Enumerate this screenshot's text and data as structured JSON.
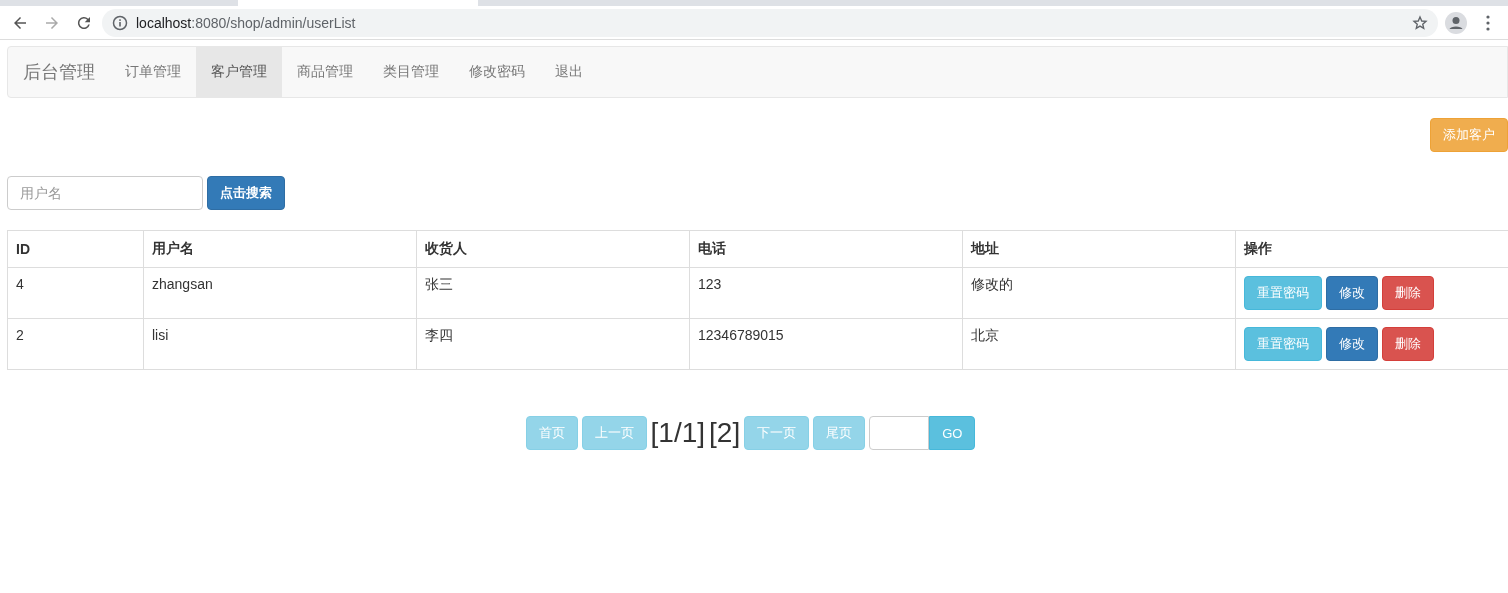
{
  "browser": {
    "url_host": "localhost",
    "url_rest": ":8080/shop/admin/userList"
  },
  "navbar": {
    "brand": "后台管理",
    "items": [
      {
        "label": "订单管理",
        "selected": false
      },
      {
        "label": "客户管理",
        "selected": true
      },
      {
        "label": "商品管理",
        "selected": false
      },
      {
        "label": "类目管理",
        "selected": false
      },
      {
        "label": "修改密码",
        "selected": false
      },
      {
        "label": "退出",
        "selected": false
      }
    ]
  },
  "add_button": "添加客户",
  "search": {
    "placeholder": "用户名",
    "button": "点击搜索"
  },
  "table": {
    "columns": [
      "ID",
      "用户名",
      "收货人",
      "电话",
      "地址",
      "操作"
    ],
    "rows": [
      {
        "cells": [
          "4",
          "zhangsan",
          "张三",
          "123",
          "修改的"
        ],
        "actions": [
          {
            "label": "重置密码",
            "kind": "info"
          },
          {
            "label": "修改",
            "kind": "primary"
          },
          {
            "label": "删除",
            "kind": "danger"
          }
        ]
      },
      {
        "cells": [
          "2",
          "lisi",
          "李四",
          "12346789015",
          "北京"
        ],
        "actions": [
          {
            "label": "重置密码",
            "kind": "info"
          },
          {
            "label": "修改",
            "kind": "primary"
          },
          {
            "label": "删除",
            "kind": "danger"
          }
        ]
      }
    ]
  },
  "pager": {
    "before": [
      {
        "label": "首页",
        "disabled": true
      },
      {
        "label": "上一页",
        "disabled": true
      }
    ],
    "status": "[1/1]",
    "total": "[2]",
    "after": [
      {
        "label": "下一页",
        "disabled": true
      },
      {
        "label": "尾页",
        "disabled": true
      }
    ],
    "go": {
      "label": "GO",
      "disabled": false
    }
  }
}
